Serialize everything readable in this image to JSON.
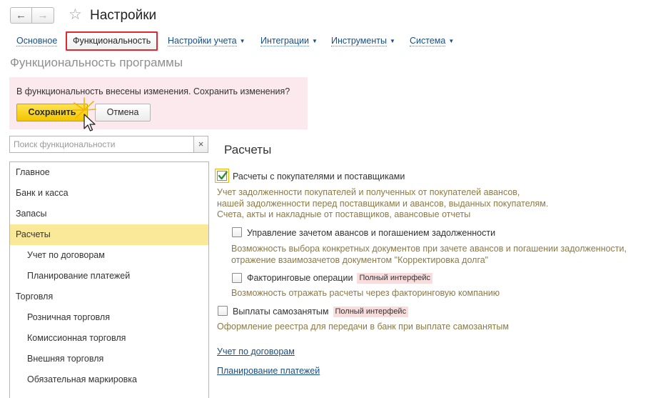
{
  "header": {
    "back_icon": "arrow-left-icon",
    "forward_icon": "arrow-right-icon",
    "favorite_icon": "star-icon",
    "title": "Настройки"
  },
  "tabs": [
    {
      "label": "Основное",
      "dropdown": false,
      "active": false
    },
    {
      "label": "Функциональность",
      "dropdown": false,
      "active": true
    },
    {
      "label": "Настройки учета",
      "dropdown": true,
      "active": false
    },
    {
      "label": "Интеграции",
      "dropdown": true,
      "active": false
    },
    {
      "label": "Инструменты",
      "dropdown": true,
      "active": false
    },
    {
      "label": "Система",
      "dropdown": true,
      "active": false
    }
  ],
  "section_title": "Функциональность программы",
  "notice": {
    "text": "В функциональность внесены изменения. Сохранить изменения?",
    "save_label": "Сохранить",
    "cancel_label": "Отмена",
    "background": "#fbe9ee"
  },
  "search": {
    "placeholder": "Поиск функциональности",
    "value": "",
    "clear_glyph": "×"
  },
  "sidebar": {
    "items": [
      {
        "label": "Главное",
        "level": 0,
        "selected": false
      },
      {
        "label": "Банк и касса",
        "level": 0,
        "selected": false
      },
      {
        "label": "Запасы",
        "level": 0,
        "selected": false
      },
      {
        "label": "Расчеты",
        "level": 0,
        "selected": true
      },
      {
        "label": "Учет по договорам",
        "level": 1,
        "selected": false
      },
      {
        "label": "Планирование платежей",
        "level": 1,
        "selected": false
      },
      {
        "label": "Торговля",
        "level": 0,
        "selected": false
      },
      {
        "label": "Розничная торговля",
        "level": 1,
        "selected": false
      },
      {
        "label": "Комиссионная торговля",
        "level": 1,
        "selected": false
      },
      {
        "label": "Внешняя торговля",
        "level": 1,
        "selected": false
      },
      {
        "label": "Обязательная маркировка",
        "level": 1,
        "selected": false
      }
    ]
  },
  "main": {
    "title": "Расчеты",
    "options": {
      "customers": {
        "label": "Расчеты с покупателями и поставщиками",
        "checked": true,
        "description": [
          "Учет задолженности покупателей и полученных от покупателей авансов,",
          "нашей задолженности перед поставщиками и авансов, выданных покупателям.",
          "Счета, акты и накладные от поставщиков, авансовые отчеты"
        ]
      },
      "advances": {
        "label": "Управление зачетом авансов и погашением задолженности",
        "checked": false,
        "description": [
          "Возможность выбора конкретных документов при зачете авансов и погашении задолженности,",
          "отражение взаимозачетов документом \"Корректировка долга\""
        ]
      },
      "factoring": {
        "label": "Факторинговые операции",
        "badge": "Полный интерфейс",
        "checked": false,
        "description": [
          "Возможность отражать расчеты через факторинговую компанию"
        ]
      },
      "selfemployed": {
        "label": "Выплаты самозанятым",
        "badge": "Полный интерфейс",
        "checked": false,
        "description": [
          "Оформление реестра для передачи в банк при выплате самозанятым"
        ]
      }
    },
    "links": {
      "contracts": "Учет по договорам",
      "payments": "Планирование платежей"
    }
  },
  "colors": {
    "accent_yellow": "#f3c500",
    "link": "#1a4e86",
    "active_tab_border": "#e0282e",
    "selected_row": "#fbe99a",
    "description_text": "#8c7a45",
    "badge_bg": "#f9dcdc"
  }
}
